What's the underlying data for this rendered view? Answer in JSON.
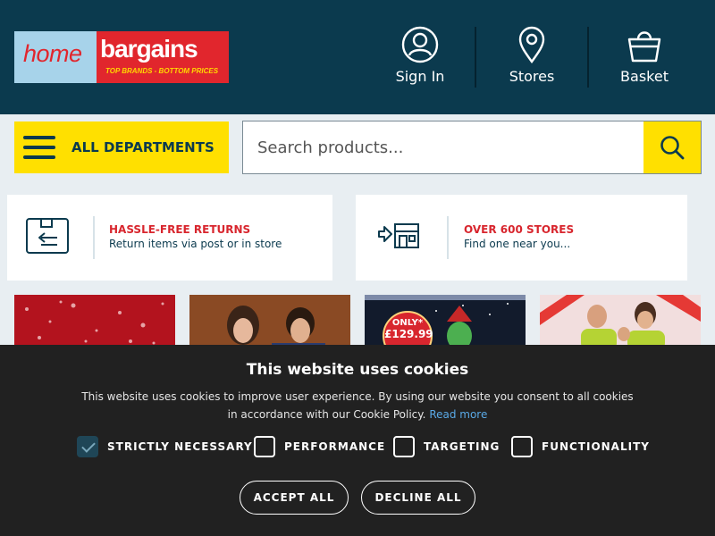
{
  "header": {
    "logo": {
      "home": "home",
      "bargains": "bargains",
      "tagline": "TOP BRANDS - BOTTOM PRICES"
    },
    "nav": [
      {
        "label": "Sign In",
        "icon": "user-icon"
      },
      {
        "label": "Stores",
        "icon": "map-pin-icon"
      },
      {
        "label": "Basket",
        "icon": "basket-icon"
      }
    ]
  },
  "search": {
    "departments_label": "ALL DEPARTMENTS",
    "placeholder": "Search products..."
  },
  "info_cards": [
    {
      "title": "HASSLE-FREE RETURNS",
      "subtitle": "Return items via post or in store",
      "icon": "returns-box-icon"
    },
    {
      "title": "OVER 600 STORES",
      "subtitle": "Find one near you...",
      "icon": "store-icon"
    }
  ],
  "promo": {
    "badge_only": "ONLY*",
    "badge_price": "£129.99"
  },
  "cookie": {
    "title": "This website uses cookies",
    "text": "This website uses cookies to improve user experience. By using our website you consent to all cookies in accordance with our Cookie Policy.",
    "read_more": "Read more",
    "options": [
      {
        "label": "STRICTLY NECESSARY",
        "checked": true
      },
      {
        "label": "PERFORMANCE",
        "checked": false
      },
      {
        "label": "TARGETING",
        "checked": false
      },
      {
        "label": "FUNCTIONALITY",
        "checked": false
      }
    ],
    "accept_label": "ACCEPT ALL",
    "decline_label": "DECLINE ALL"
  },
  "colors": {
    "header_bg": "#0b3a4e",
    "accent_yellow": "#ffe000",
    "brand_red": "#e1262d",
    "cookie_bg": "#212121"
  }
}
